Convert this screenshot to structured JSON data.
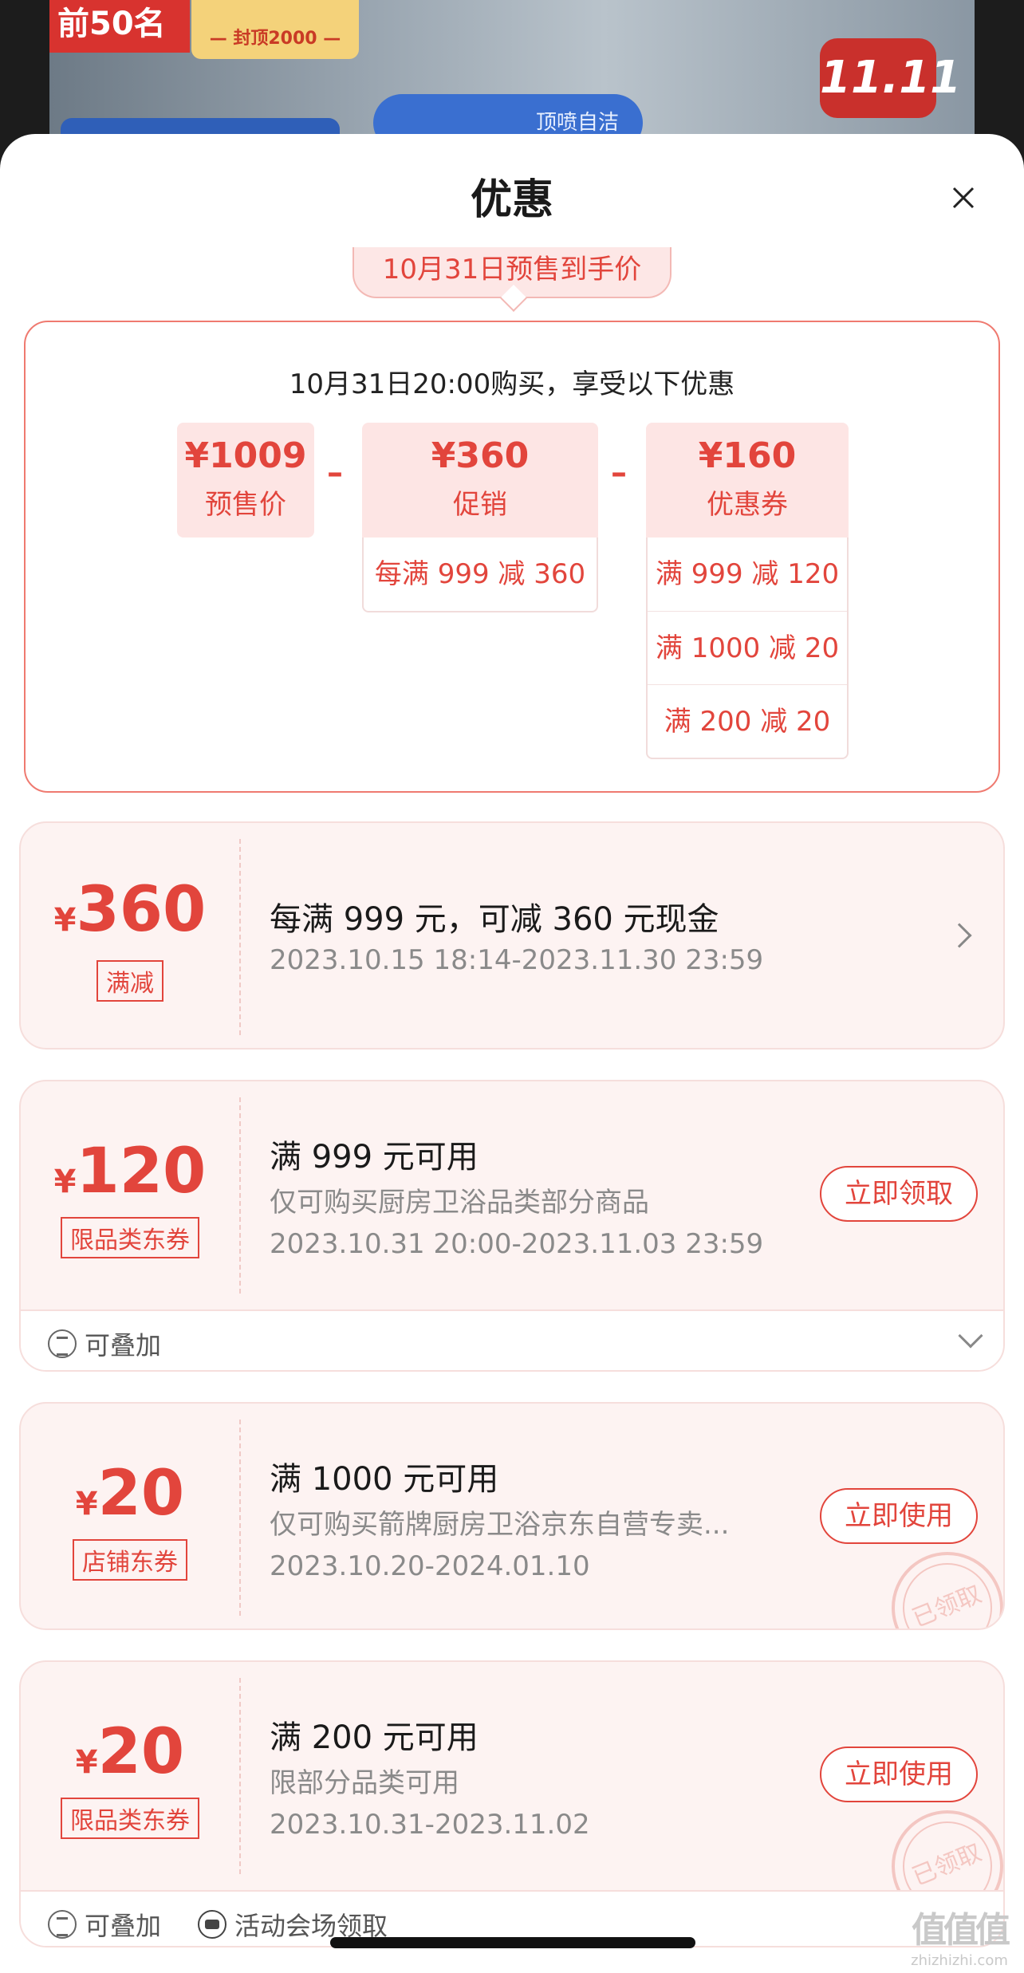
{
  "background": {
    "rank_tag": "前50名",
    "cap_tag": "— 封顶2000 —",
    "event_badge": "11.11",
    "feature_pill": "顶喷自洁"
  },
  "sheet": {
    "title": "优惠"
  },
  "presale": {
    "tab_label": "10月31日预售到手价",
    "headline": "10月31日20:00购买，享受以下优惠",
    "minus_sign": "–",
    "base": {
      "amount": "¥1009",
      "label": "预售价"
    },
    "promo": {
      "amount": "¥360",
      "label": "促销",
      "items": [
        "每满 999 减 360"
      ]
    },
    "coupon": {
      "amount": "¥160",
      "label": "优惠券",
      "items": [
        "满 999 减 120",
        "满 1000 减 20",
        "满 200 减 20"
      ]
    }
  },
  "coupons": [
    {
      "currency": "¥",
      "value": "360",
      "tag": "满减",
      "title": "每满 999 元，可减 360 元现金",
      "date": "2023.10.15 18:14-2023.11.30 23:59"
    },
    {
      "currency": "¥",
      "value": "120",
      "tag": "限品类东券",
      "title": "满 999 元可用",
      "desc": "仅可购买厨房卫浴品类部分商品",
      "date": "2023.10.31 20:00-2023.11.03 23:59",
      "action": "立即领取",
      "footer": [
        "可叠加"
      ]
    },
    {
      "currency": "¥",
      "value": "20",
      "tag": "店铺东券",
      "title": "满 1000 元可用",
      "desc": "仅可购买箭牌厨房卫浴京东自营专卖...",
      "date": "2023.10.20-2024.01.10",
      "action": "立即使用",
      "stamp": "已领取"
    },
    {
      "currency": "¥",
      "value": "20",
      "tag": "限品类东券",
      "title": "满 200 元可用",
      "desc": "限部分品类可用",
      "date": "2023.10.31-2023.11.02",
      "action": "立即使用",
      "stamp": "已领取",
      "footer": [
        "可叠加",
        "活动会场领取"
      ]
    }
  ],
  "watermark": {
    "logo": "值值值",
    "text": "zhizhizhi.com"
  }
}
